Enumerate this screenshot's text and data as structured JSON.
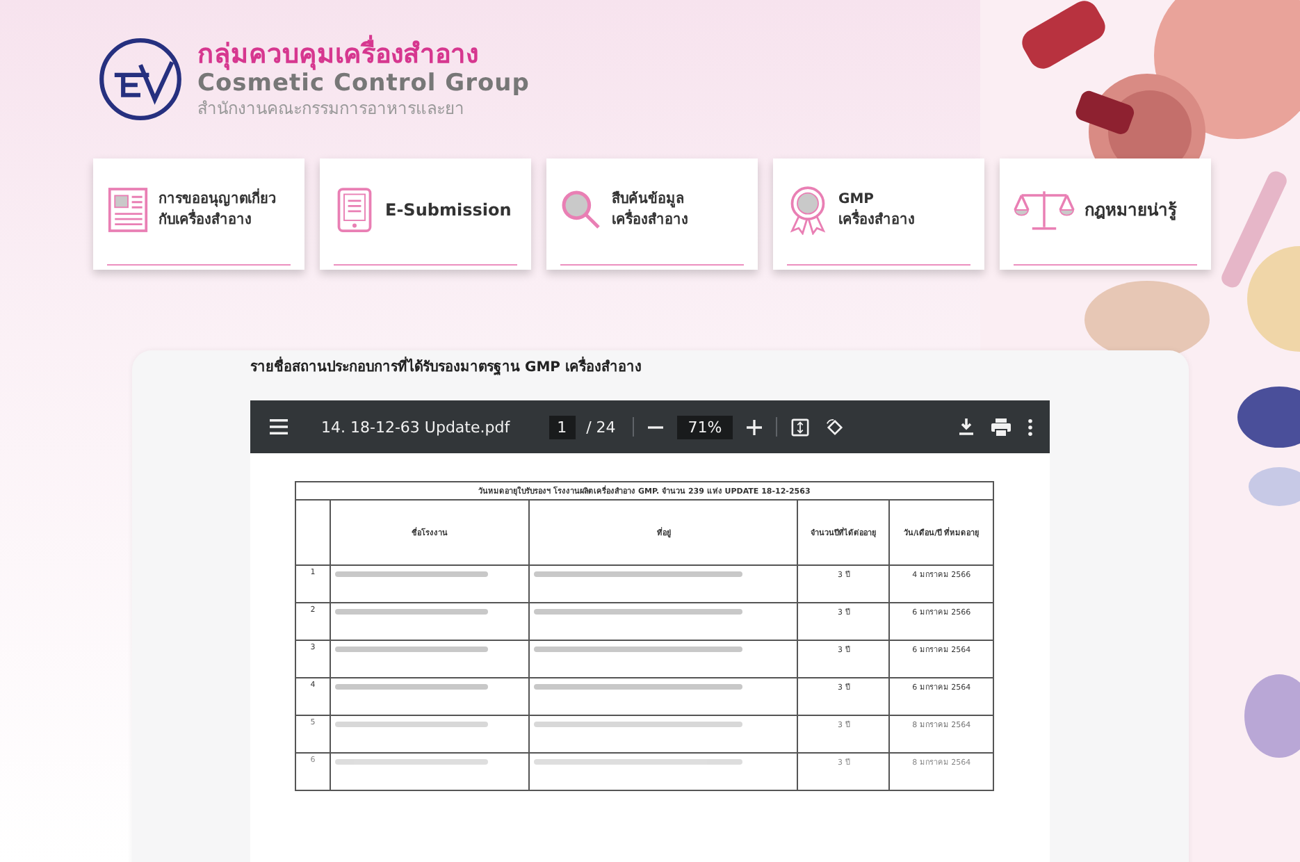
{
  "header": {
    "title_th": "กลุ่มควบคุมเครื่องสำอาง",
    "title_en": "Cosmetic Control Group",
    "subtitle": "สำนักงานคณะกรรมการอาหารและยา"
  },
  "menu_cards": [
    {
      "kind": "document",
      "lines": [
        "การขออนุญาตเกี่ยว",
        "กับเครื่องสำอาง"
      ]
    },
    {
      "kind": "tablet",
      "lines": [
        "E-Submission"
      ]
    },
    {
      "kind": "search",
      "lines": [
        "สืบค้นข้อมูล",
        "เครื่องสำอาง"
      ]
    },
    {
      "kind": "award",
      "lines": [
        "GMP",
        "เครื่องสำอาง"
      ]
    },
    {
      "kind": "scales",
      "lines": [
        "กฎหมายน่ารู้"
      ]
    }
  ],
  "section_title": "รายชื่อสถานประกอบการที่ได้รับรองมาตรฐาน GMP เครื่องสำอาง",
  "pdf_viewer": {
    "file_name": "14. 18-12-63 Update.pdf",
    "page": "1",
    "page_total": "/ 24",
    "zoom": "71%",
    "document": {
      "caption": "วันหมดอายุใบรับรองฯ โรงงานผลิตเครื่องสำอาง GMP. จำนวน 239 แห่ง UPDATE  18-12-2563",
      "columns": [
        "ชื่อโรงงาน",
        "ที่อยู่",
        "จำนวนปีที่ได้ต่ออายุ",
        "วัน/เดือน/ปี ที่หมดอายุ"
      ],
      "rows": [
        {
          "no": "1",
          "years": "3 ปี",
          "expiry": "4 มกราคม 2566"
        },
        {
          "no": "2",
          "years": "3 ปี",
          "expiry": "6 มกราคม 2566"
        },
        {
          "no": "3",
          "years": "3 ปี",
          "expiry": "6 มกราคม 2564"
        },
        {
          "no": "4",
          "years": "3 ปี",
          "expiry": "6 มกราคม 2564"
        },
        {
          "no": "5",
          "years": "3 ปี",
          "expiry": "8 มกราคม 2564"
        },
        {
          "no": "6",
          "years": "3 ปี",
          "expiry": "8 มกราคม 2564"
        }
      ]
    }
  }
}
